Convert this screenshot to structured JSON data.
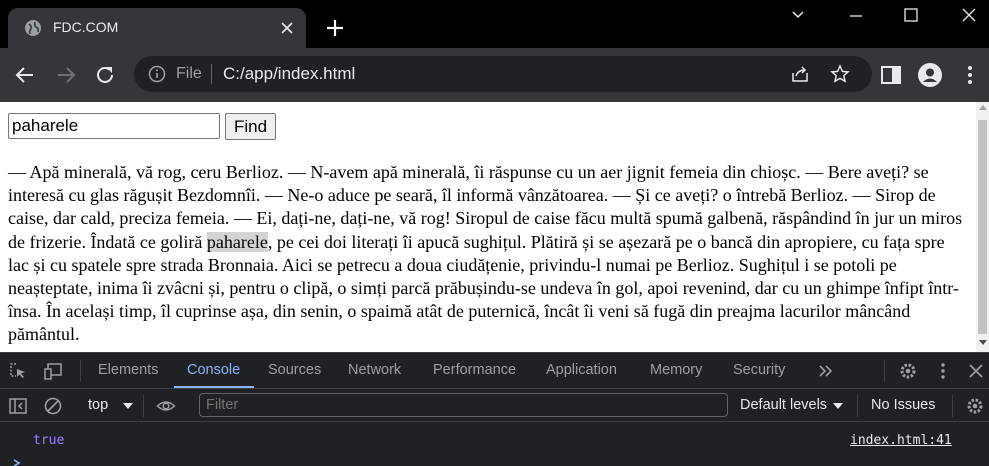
{
  "browser": {
    "tab_title": "FDC.COM",
    "scheme_label": "File",
    "url": "C:/app/index.html"
  },
  "page": {
    "search_value": "paharele",
    "find_label": "Find",
    "paragraph_before": "— Apă minerală, vă rog, ceru Berlioz. — N-avem apă minerală, îi răspunse cu un aer jignit femeia din chioșc. — Bere aveți? se interesă cu glas răgușit Bezdomnîi. — Ne-o aduce pe seară, îl informă vânzătoarea. — Și ce aveți? o întrebă Berlioz. — Sirop de caise, dar cald, preciza femeia. — Ei, dați-ne, dați-ne, vă rog! Siropul de caise făcu multă spumă galbenă, răspândind în jur un miros de frizerie. Îndată ce goliră ",
    "highlight": "paharele",
    "paragraph_after": ", pe cei doi literați îi apucă sughițul. Plătiră și se așezară pe o bancă din apropiere, cu fața spre lac și cu spatele spre strada Bronnaia. Aici se petrecu a doua ciudățenie, privindu-l numai pe Berlioz. Sughițul i se potoli pe neașteptate, inima îi zvâcni și, pentru o clipă, o simți parcă prăbușindu-se undeva în gol, apoi revenind, dar cu un ghimpe înfipt într-însa. În același timp, îl cuprinse așa, din senin, o spaimă atât de puternică, încât îi veni să fugă din preajma lacurilor mâncând pământul."
  },
  "devtools": {
    "tabs": [
      "Elements",
      "Console",
      "Sources",
      "Network",
      "Performance",
      "Application",
      "Memory",
      "Security"
    ],
    "active_tab": "Console",
    "context": "top",
    "filter_placeholder": "Filter",
    "levels_label": "Default levels",
    "issues_label": "No Issues",
    "log": {
      "value": "true",
      "source": "index.html:41"
    }
  },
  "colors": {
    "accent": "#8ab4f8",
    "log_value": "#9980ff",
    "highlight": "#d4d4d4"
  }
}
